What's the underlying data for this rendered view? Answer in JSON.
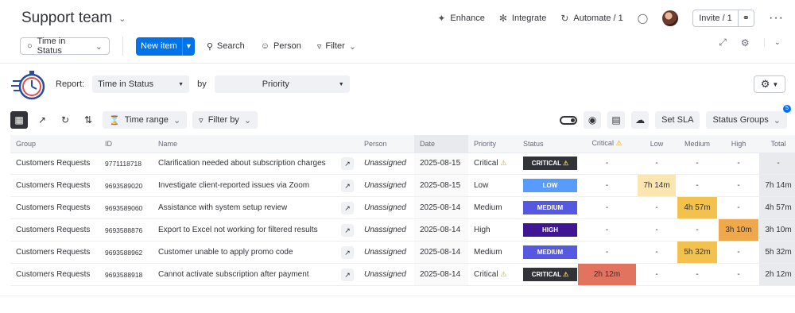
{
  "header": {
    "title": "Support team",
    "enhance": "Enhance",
    "integrate": "Integrate",
    "automate": "Automate / 1",
    "invite": "Invite / 1"
  },
  "toolbar": {
    "view": "Time in Status",
    "new_item": "New item",
    "search": "Search",
    "person": "Person",
    "filter": "Filter"
  },
  "report": {
    "label": "Report:",
    "type": "Time in Status",
    "by_label": "by",
    "by": "Priority"
  },
  "table_toolbar": {
    "time_range": "Time range",
    "filter_by": "Filter by",
    "set_sla": "Set SLA",
    "status_groups": "Status Groups",
    "status_groups_count": "5"
  },
  "columns": [
    "Group",
    "ID",
    "Name",
    "Person",
    "Date",
    "Priority",
    "Status",
    "Critical",
    "Low",
    "Medium",
    "High",
    "Total"
  ],
  "status_colors": {
    "CRITICAL": "#323338",
    "LOW": "#579bfc",
    "MEDIUM": "#5559df",
    "HIGH": "#401694"
  },
  "duration_colors": {
    "Critical": "#e2735f",
    "Low": "#fbe5b0",
    "Medium": "#f2c14e",
    "High": "#f0a84c"
  },
  "rows": [
    {
      "group": "Customers Requests",
      "id": "9771118718",
      "name": "Clarification needed about subscription charges",
      "person": "Unassigned",
      "date": "2025-08-15",
      "priority": "Critical",
      "status": "CRITICAL",
      "critical": "-",
      "low": "-",
      "medium": "-",
      "high": "-",
      "total": "-"
    },
    {
      "group": "Customers Requests",
      "id": "9693589020",
      "name": "Investigate client-reported issues via Zoom",
      "person": "Unassigned",
      "date": "2025-08-15",
      "priority": "Low",
      "status": "LOW",
      "critical": "-",
      "low": "7h 14m",
      "medium": "-",
      "high": "-",
      "total": "7h 14m"
    },
    {
      "group": "Customers Requests",
      "id": "9693589060",
      "name": "Assistance with system setup review",
      "person": "Unassigned",
      "date": "2025-08-14",
      "priority": "Medium",
      "status": "MEDIUM",
      "critical": "-",
      "low": "-",
      "medium": "4h 57m",
      "high": "-",
      "total": "4h 57m"
    },
    {
      "group": "Customers Requests",
      "id": "9693588876",
      "name": "Export to Excel not working for filtered results",
      "person": "Unassigned",
      "date": "2025-08-14",
      "priority": "High",
      "status": "HIGH",
      "critical": "-",
      "low": "-",
      "medium": "-",
      "high": "3h 10m",
      "total": "3h 10m"
    },
    {
      "group": "Customers Requests",
      "id": "9693588962",
      "name": "Customer unable to apply promo code",
      "person": "Unassigned",
      "date": "2025-08-14",
      "priority": "Medium",
      "status": "MEDIUM",
      "critical": "-",
      "low": "-",
      "medium": "5h 32m",
      "high": "-",
      "total": "5h 32m"
    },
    {
      "group": "Customers Requests",
      "id": "9693588918",
      "name": "Cannot activate subscription after payment",
      "person": "Unassigned",
      "date": "2025-08-14",
      "priority": "Critical",
      "status": "CRITICAL",
      "critical": "2h 12m",
      "low": "-",
      "medium": "-",
      "high": "-",
      "total": "2h 12m"
    }
  ]
}
